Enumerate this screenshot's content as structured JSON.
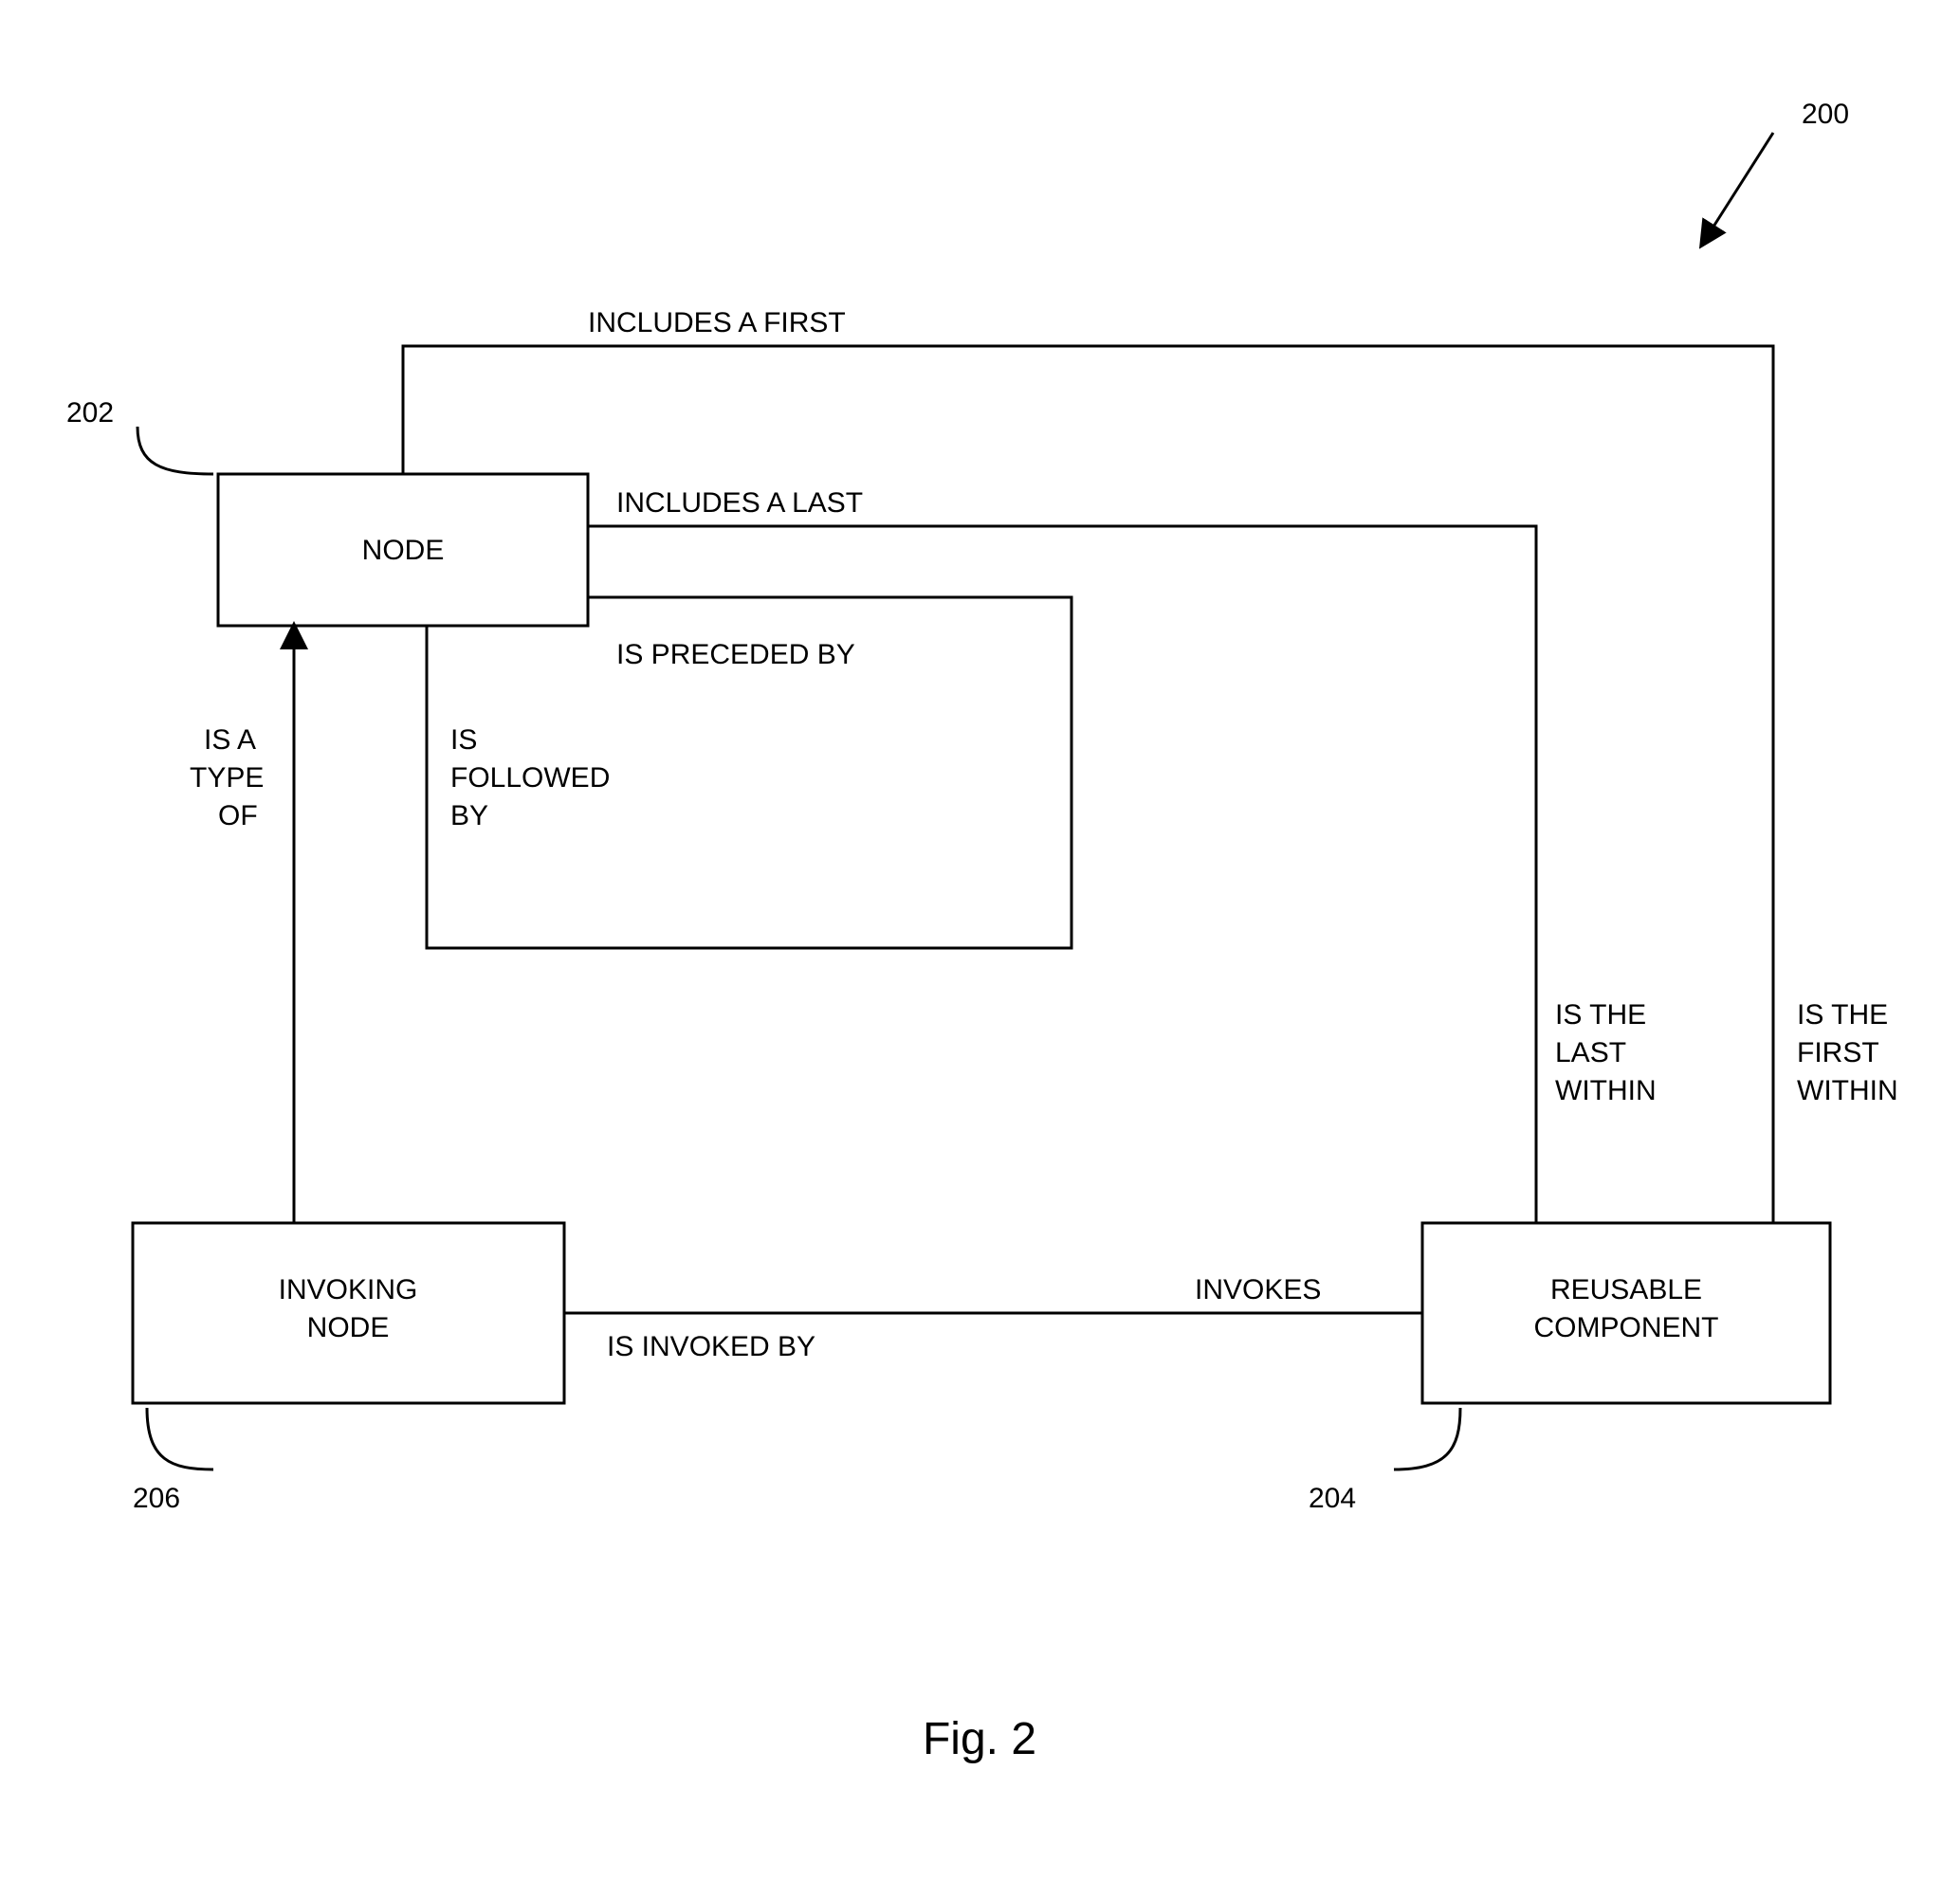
{
  "figure": {
    "caption": "Fig. 2",
    "ref_200": "200",
    "ref_202": "202",
    "ref_204": "204",
    "ref_206": "206"
  },
  "boxes": {
    "node": "NODE",
    "invoking_node_l1": "INVOKING",
    "invoking_node_l2": "NODE",
    "reusable_l1": "REUSABLE",
    "reusable_l2": "COMPONENT"
  },
  "edges": {
    "includes_first": "INCLUDES A FIRST",
    "includes_last": "INCLUDES A LAST",
    "is_preceded_by": "IS PRECEDED BY",
    "is_followed_by_l1": "IS",
    "is_followed_by_l2": "FOLLOWED",
    "is_followed_by_l3": "BY",
    "is_a_type_of_l1": "IS A",
    "is_a_type_of_l2": "TYPE",
    "is_a_type_of_l3": "OF",
    "invokes": "INVOKES",
    "is_invoked_by": "IS INVOKED BY",
    "is_the_last_within_l1": "IS THE",
    "is_the_last_within_l2": "LAST",
    "is_the_last_within_l3": "WITHIN",
    "is_the_first_within_l1": "IS THE",
    "is_the_first_within_l2": "FIRST",
    "is_the_first_within_l3": "WITHIN"
  }
}
